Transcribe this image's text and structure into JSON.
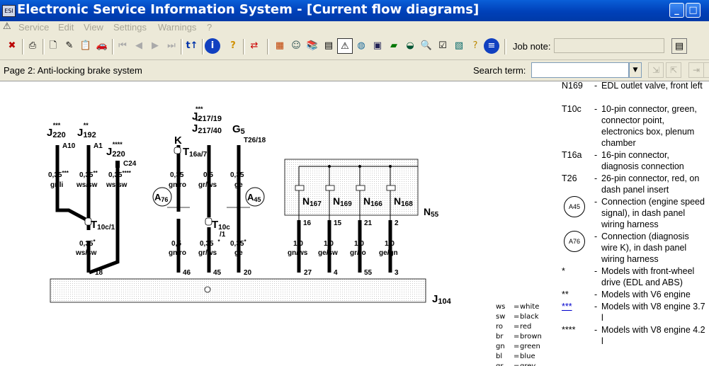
{
  "window": {
    "title": "Electronic Service Information System - [Current flow diagrams]",
    "app_icon": "ESI",
    "minimize": "_",
    "maximize": "□",
    "close": "×"
  },
  "menu": [
    {
      "label": "Service"
    },
    {
      "label": "Edit"
    },
    {
      "label": "View"
    },
    {
      "label": "Settings"
    },
    {
      "label": "Warnings"
    },
    {
      "label": "?"
    }
  ],
  "toolbar": {
    "jobnote_label": "Job note:",
    "jobnote_value": ""
  },
  "page": {
    "title": "Page 2: Anti-locking brake system",
    "search_label": "Search term:",
    "search_value": ""
  },
  "diagram": {
    "components": {
      "j220a": "J",
      "j220a_sub": "220",
      "j220a_sup": "***",
      "j192": "J",
      "j192_sub": "192",
      "j192_sup": "**",
      "j220b": "J",
      "j220b_sub": "220",
      "j220b_sup": "****",
      "j217a": "J",
      "j217a_sub": "217/19",
      "j217a_sup": "***",
      "j217b": "J",
      "j217b_sub": "217/40",
      "j217b_sup": "**",
      "k": "K",
      "g5": "G",
      "g5_sub": "5",
      "t16a": "T",
      "t16a_sub": "16a/7",
      "t10c1": "T",
      "t10c1_sub": "10c/1",
      "t10c2": "T",
      "t10c2_sub": "10c",
      "t10c2_pin": "/1",
      "a76": "A",
      "a76_sub": "76",
      "a45": "A",
      "a45_sub": "45",
      "n167": "N",
      "n167_sub": "167",
      "n169": "N",
      "n169_sub": "169",
      "n166": "N",
      "n166_sub": "166",
      "n168": "N",
      "n168_sub": "168",
      "n55": "N",
      "n55_sub": "55",
      "j104": "J",
      "j104_sub": "104",
      "c24": "C24",
      "a10": "A10",
      "a1": "A1",
      "t26_18": "T26/18"
    },
    "wires_top": [
      {
        "size": "0,35",
        "suffix": "***",
        "color": "gr/li"
      },
      {
        "size": "0,35",
        "suffix": "**",
        "color": "ws/sw"
      },
      {
        "size": "0,35",
        "suffix": "****",
        "color": "ws/sw"
      },
      {
        "size": "0,35",
        "suffix": "",
        "color": "gn/ro"
      },
      {
        "size": "0,5",
        "suffix": "",
        "color": "gr/ws"
      },
      {
        "size": "0,35",
        "suffix": "",
        "color": "ge"
      }
    ],
    "wires_mid": [
      {
        "size": "0,35",
        "suffix": "*",
        "color": "ws/sw"
      },
      {
        "size": "0,5",
        "suffix": "",
        "color": "gn/ro"
      },
      {
        "size": "0,35",
        "suffix": "*",
        "color": "gr/ws"
      },
      {
        "size": "0,35",
        "suffix": "*",
        "color": "ge"
      }
    ],
    "wires_valves": [
      {
        "pin": "16",
        "size": "1,0",
        "color": "gn/ws"
      },
      {
        "pin": "15",
        "size": "1,0",
        "color": "ge/sw"
      },
      {
        "pin": "21",
        "size": "1,0",
        "color": "gr/ro"
      },
      {
        "pin": "2",
        "size": "1,0",
        "color": "ge/gn"
      }
    ],
    "pins_bottom": [
      "18",
      "46",
      "45",
      "20",
      "27",
      "4",
      "55",
      "3"
    ]
  },
  "components_list": [
    {
      "code": "N169",
      "desc": "EDL outlet valve, front left"
    },
    {
      "code": "T10c",
      "desc": "10-pin connector, green, connector point, electronics box, plenum chamber"
    },
    {
      "code": "T16a",
      "desc": "16-pin connector, diagnosis connection"
    },
    {
      "code": "T26",
      "desc": "26-pin connector, red, on dash panel insert"
    },
    {
      "code": "A45",
      "desc": "Connection (engine speed signal), in dash panel wiring harness"
    },
    {
      "code": "A76",
      "desc": "Connection (diagnosis wire K), in dash panel wiring harness"
    },
    {
      "code": "*",
      "desc": "Models with front-wheel drive (EDL and ABS)"
    },
    {
      "code": "**",
      "desc": "Models with V6 engine"
    },
    {
      "code": "***",
      "desc": "Models with V8 engine 3.7 l"
    },
    {
      "code": "****",
      "desc": "Models with V8 engine 4.2 l"
    }
  ],
  "color_legend": [
    {
      "code": "ws",
      "name": "white"
    },
    {
      "code": "sw",
      "name": "black"
    },
    {
      "code": "ro",
      "name": "red"
    },
    {
      "code": "br",
      "name": "brown"
    },
    {
      "code": "gn",
      "name": "green"
    },
    {
      "code": "bl",
      "name": "blue"
    },
    {
      "code": "gr",
      "name": "grey"
    }
  ],
  "colors": {
    "titlebar": "#0a5fd8",
    "link": "#0000cc",
    "menu_disabled": "#a8a596"
  }
}
